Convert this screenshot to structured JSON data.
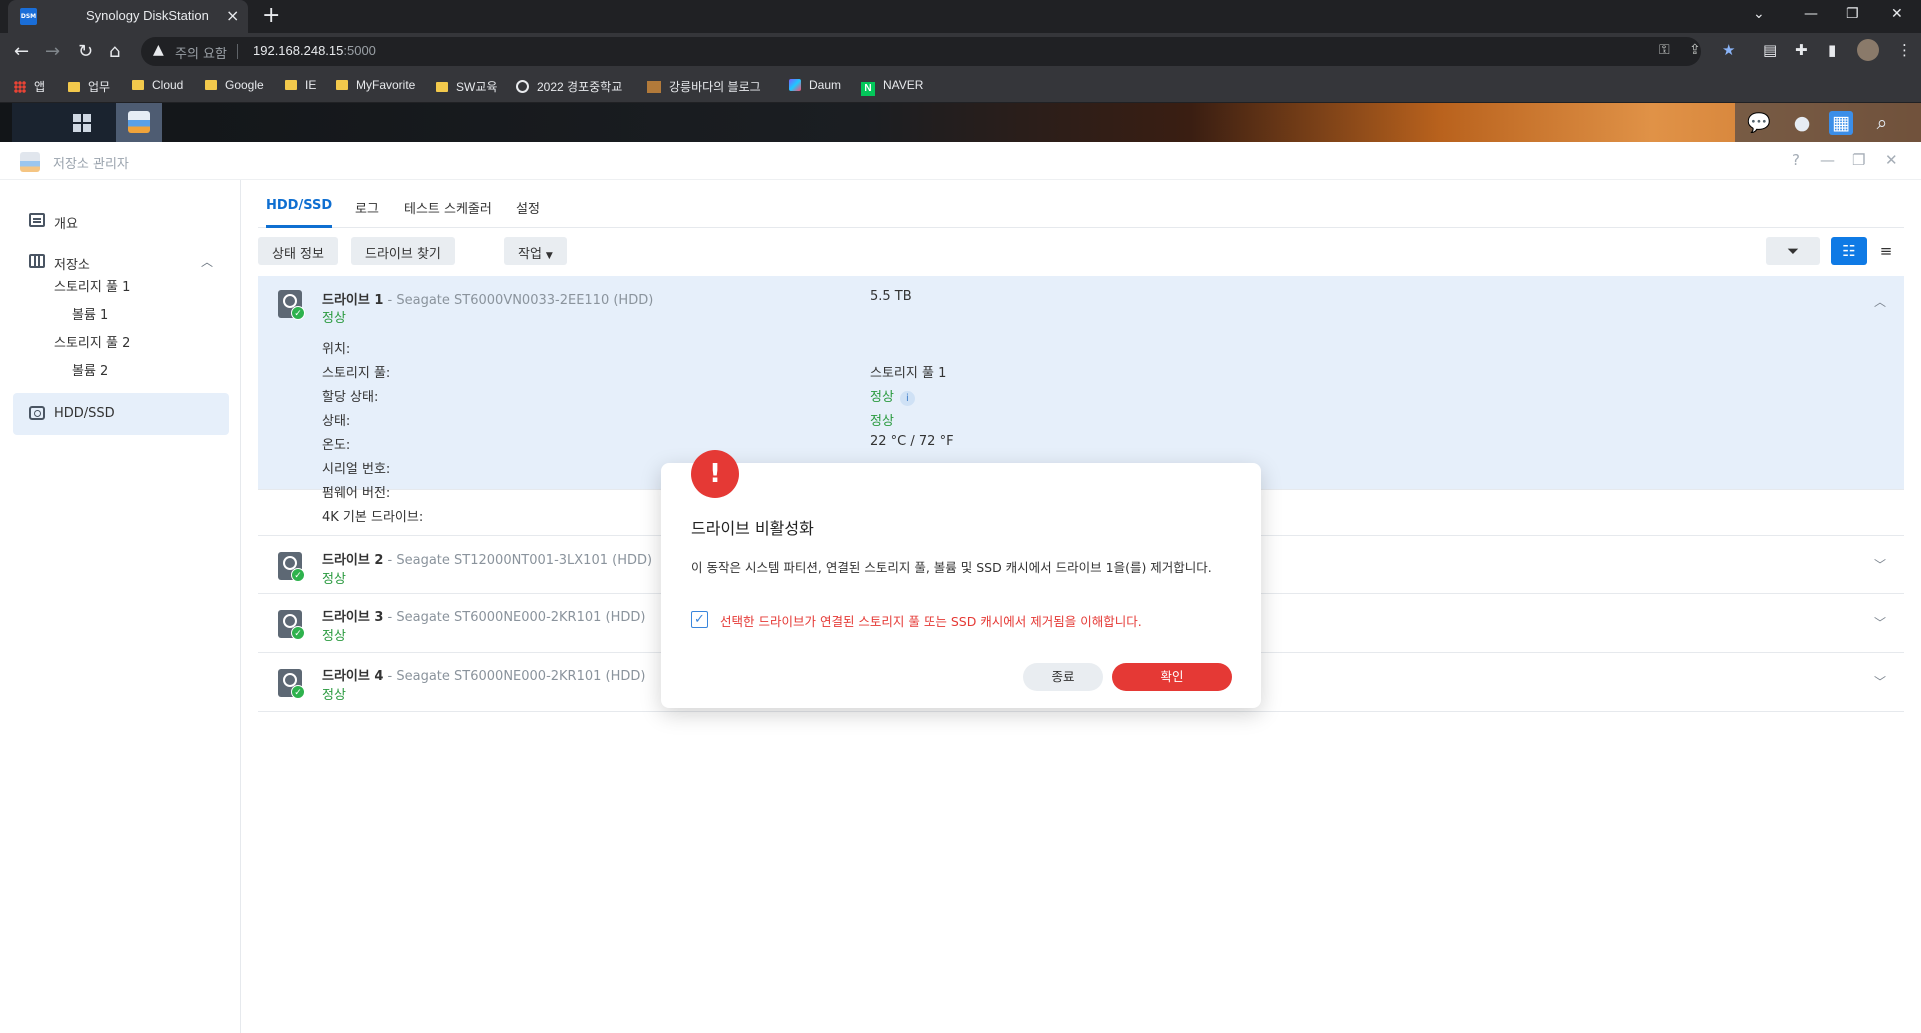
{
  "browser": {
    "tab_title": "Synology DiskStation",
    "favicon_text": "DSM",
    "new_tab": "+",
    "close_tab": "×",
    "warning_text": "주의 요함",
    "url_host": "192.168.248.15",
    "url_port": ":5000"
  },
  "bookmarks": [
    "앱",
    "업무",
    "Cloud",
    "Google",
    "IE",
    "MyFavorite",
    "SW교육",
    "2022 경포중학교",
    "강릉바다의 블로그",
    "Daum",
    "NAVER"
  ],
  "window": {
    "title": "저장소 관리자",
    "help": "?",
    "minimize": "—",
    "restore": "❐",
    "close": "✕"
  },
  "sidebar": {
    "overview": "개요",
    "storage": "저장소",
    "pool1": "스토리지 풀 1",
    "volume1": "볼륨 1",
    "pool2": "스토리지 풀 2",
    "volume2": "볼륨 2",
    "hddssd": "HDD/SSD"
  },
  "tabs": [
    "HDD/SSD",
    "로그",
    "테스트 스케줄러",
    "설정"
  ],
  "toolbar": {
    "status_info": "상태 정보",
    "find_drive": "드라이브 찾기",
    "action": "작업"
  },
  "drives": [
    {
      "label": "드라이브 1",
      "model": " - Seagate ST6000VN0033-2EE110 (HDD)",
      "status": "정상",
      "size": "5.5 TB"
    },
    {
      "label": "드라이브 2",
      "model": " - Seagate ST12000NT001-3LX101 (HDD)",
      "status": "정상"
    },
    {
      "label": "드라이브 3",
      "model": " - Seagate ST6000NE000-2KR101 (HDD)",
      "status": "정상"
    },
    {
      "label": "드라이브 4",
      "model": " - Seagate ST6000NE000-2KR101 (HDD)",
      "status": "정상"
    }
  ],
  "drive1_details": {
    "location_label": "위치:",
    "pool_label": "스토리지 풀:",
    "pool_value": "스토리지 풀 1",
    "alloc_label": "할당 상태:",
    "alloc_value": "정상",
    "state_label": "상태:",
    "state_value": "정상",
    "temp_label": "온도:",
    "temp_value": "22 °C / 72 °F",
    "serial_label": "시리얼 번호:",
    "firmware_label": "펌웨어 버전:",
    "k4_label": "4K 기본 드라이브:"
  },
  "dialog": {
    "alert_symbol": "!",
    "title": "드라이브 비활성화",
    "body": "이 동작은 시스템 파티션, 연결된 스토리지 풀, 볼륨 및 SSD 캐시에서 드라이브 1을(를) 제거합니다.",
    "checkbox_checked": true,
    "checkbox_label": "선택한 드라이브가 연결된 스토리지 풀 또는 SSD 캐시에서 제거됨을 이해합니다.",
    "cancel": "종료",
    "ok": "확인"
  },
  "colors": {
    "accent": "#0f6fd1",
    "danger": "#e53935",
    "success": "#2a9a3f"
  }
}
